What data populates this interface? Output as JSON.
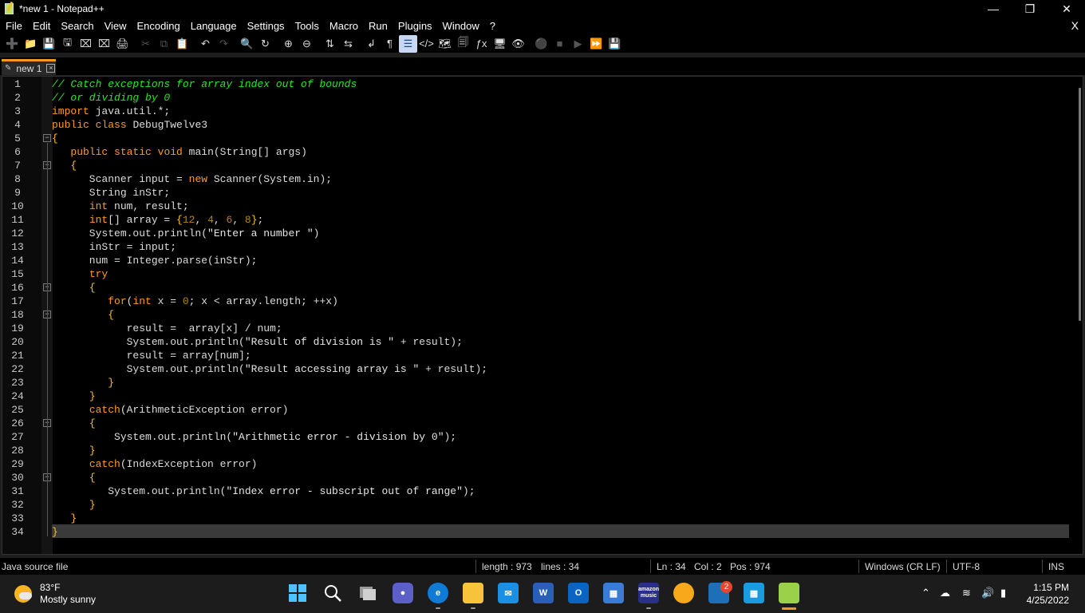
{
  "window": {
    "title": "*new 1 - Notepad++"
  },
  "menu": [
    "File",
    "Edit",
    "Search",
    "View",
    "Encoding",
    "Language",
    "Settings",
    "Tools",
    "Macro",
    "Run",
    "Plugins",
    "Window",
    "?"
  ],
  "menu_close": "X",
  "tab": {
    "label": "new 1"
  },
  "editor": {
    "line_numbers": [
      "1",
      "2",
      "3",
      "4",
      "5",
      "6",
      "7",
      "8",
      "9",
      "10",
      "11",
      "12",
      "13",
      "14",
      "15",
      "16",
      "17",
      "18",
      "19",
      "20",
      "21",
      "22",
      "23",
      "24",
      "25",
      "26",
      "27",
      "28",
      "29",
      "30",
      "31",
      "32",
      "33",
      "34"
    ],
    "lines": [
      "// Catch exceptions for array index out of bounds",
      "// or dividing by 0",
      "import java.util.*;",
      "public class DebugTwelve3",
      "{",
      "   public static void main(String[] args)",
      "   {",
      "      Scanner input = new Scanner(System.in);",
      "      String inStr;",
      "      int num, result;",
      "      int[] array = {12, 4, 6, 8};",
      "      System.out.println(\"Enter a number \")",
      "      inStr = input;",
      "      num = Integer.parse(inStr);",
      "      try",
      "      {",
      "         for(int x = 0; x < array.length; ++x)",
      "         {",
      "            result =  array[x] / num;",
      "            System.out.println(\"Result of division is \" + result);",
      "            result = array[num];",
      "            System.out.println(\"Result accessing array is \" + result);",
      "         }",
      "      }",
      "      catch(ArithmeticException error)",
      "      {",
      "          System.out.println(\"Arithmetic error - division by 0\");",
      "      }",
      "      catch(IndexException error)",
      "      {",
      "         System.out.println(\"Index error - subscript out of range\");",
      "      }",
      "   }",
      "}"
    ]
  },
  "status": {
    "file_type": "Java source file",
    "length": "length : 973",
    "lines": "lines : 34",
    "ln": "Ln : 34",
    "col": "Col : 2",
    "pos": "Pos : 974",
    "eol": "Windows (CR LF)",
    "encoding": "UTF-8",
    "mode": "INS"
  },
  "taskbar": {
    "weather_temp": "83°F",
    "weather_desc": "Mostly sunny",
    "store_badge": "2",
    "word_label": "W",
    "amazon_label": "amazon music",
    "time": "1:15 PM",
    "date": "4/25/2022"
  }
}
